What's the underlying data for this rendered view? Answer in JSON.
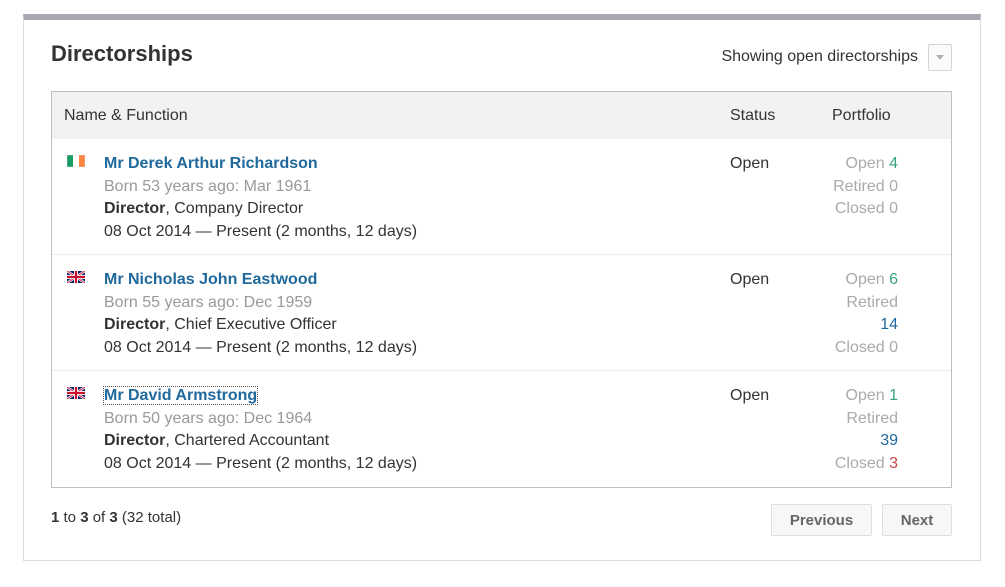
{
  "card": {
    "title": "Directorships",
    "filter_label": "Showing open directorships",
    "filter_icon": "chevron-down-icon"
  },
  "table": {
    "headers": {
      "name": "Name & Function",
      "status": "Status",
      "portfolio": "Portfolio"
    },
    "rows": [
      {
        "flag": "ireland-flag-icon",
        "name": "Mr Derek Arthur Richardson",
        "born": "Born 53 years ago: Mar 1961",
        "role_title": "Director",
        "role_function": ", Company Director",
        "dates": "08 Oct 2014 — Present (2 months, 12 days)",
        "status": "Open",
        "portfolio": {
          "open_label": "Open",
          "open_value": "4",
          "retired_label": "Retired",
          "retired_value": "0",
          "closed_label": "Closed",
          "closed_value": "0"
        }
      },
      {
        "flag": "uk-flag-icon",
        "name": "Mr Nicholas John Eastwood",
        "born": "Born 55 years ago: Dec 1959",
        "role_title": "Director",
        "role_function": ", Chief Executive Officer",
        "dates": "08 Oct 2014 — Present (2 months, 12 days)",
        "status": "Open",
        "portfolio": {
          "open_label": "Open",
          "open_value": "6",
          "retired_label": "Retired",
          "retired_value": "14",
          "closed_label": "Closed",
          "closed_value": "0"
        }
      },
      {
        "flag": "uk-flag-icon",
        "name": "Mr David Armstrong",
        "born": "Born 50 years ago: Dec 1964",
        "role_title": "Director",
        "role_function": ", Chartered Accountant",
        "dates": "08 Oct 2014 — Present (2 months, 12 days)",
        "status": "Open",
        "portfolio": {
          "open_label": "Open",
          "open_value": "1",
          "retired_label": "Retired",
          "retired_value": "39",
          "closed_label": "Closed",
          "closed_value": "3"
        }
      }
    ]
  },
  "pagination": {
    "from": "1",
    "to_word": "to",
    "to": "3",
    "of_word": "of",
    "of": "3",
    "total": "(32 total)",
    "previous_label": "Previous",
    "next_label": "Next"
  },
  "colors": {
    "link": "#20699c",
    "open_count": "#3aa37a",
    "closed_count": "#c9484a",
    "muted": "#aaaaaa",
    "top_bar": "#a7a9b2"
  }
}
